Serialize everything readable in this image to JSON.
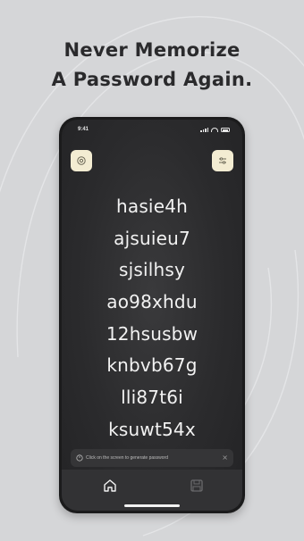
{
  "headline": {
    "line1": "Never Memorize",
    "line2": "A Password Again."
  },
  "status_bar": {
    "time": "9:41"
  },
  "header": {
    "left_icon": "gear-icon",
    "right_icon": "sliders-icon"
  },
  "passwords": [
    "hasie4h",
    "ajsuieu7",
    "sjsilhsy",
    "ao98xhdu",
    "12hsusbw",
    "knbvb67g",
    "lli87t6i",
    "ksuwt54x"
  ],
  "hint": {
    "icon": "info-icon",
    "text": "Click on the screen to generate password",
    "close": "×"
  },
  "tab_bar": {
    "items": [
      {
        "icon": "home-icon",
        "active": true
      },
      {
        "icon": "save-icon",
        "active": false
      }
    ]
  },
  "colors": {
    "background": "#d5d6d8",
    "phone_screen": "#2b2b2d",
    "accent_button": "#f3ecd2",
    "text_light": "#f2f2f2",
    "headline_text": "#2a2a2c"
  }
}
